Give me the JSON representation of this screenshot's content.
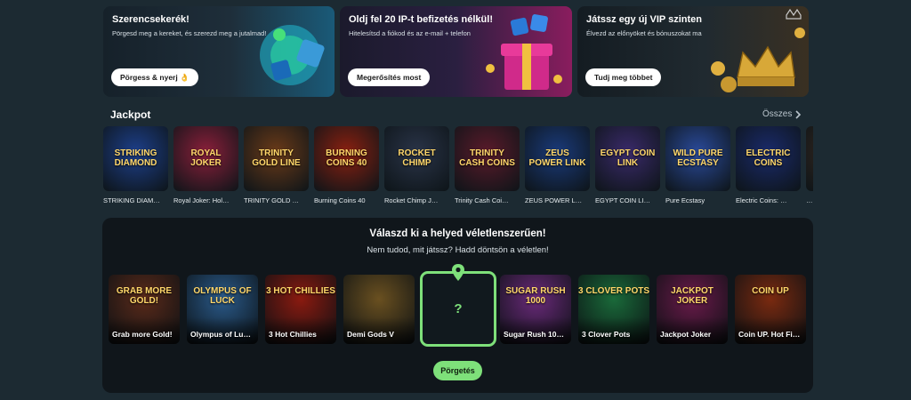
{
  "promos": [
    {
      "title": "Szerencsekerék!",
      "subtitle": "Pörgesd meg a kereket, és szerezd meg a jutalmad!",
      "button": "Pörgess & nyerj 👌"
    },
    {
      "title": "Oldj fel 20 IP-t befizetés nélkül!",
      "subtitle": "Hitelesítsd a fiókod és az e-mail + telefon",
      "button": "Megerősítés most"
    },
    {
      "title": "Játssz egy új VIP szinten",
      "subtitle": "Élvezd az előnyöket és bónuszokat ma",
      "button": "Tudj meg többet"
    }
  ],
  "jackpot": {
    "title": "Jackpot",
    "see_all": "Összes",
    "games": [
      {
        "name": "STRIKING DIAM…",
        "logo": "STRIKING DIAMOND",
        "color": "#1d3f8a"
      },
      {
        "name": "Royal Joker: Hol…",
        "logo": "ROYAL JOKER",
        "color": "#8a1f3a"
      },
      {
        "name": "TRINITY GOLD …",
        "logo": "TRINITY GOLD LINE",
        "color": "#6a3a18"
      },
      {
        "name": "Burning Coins 40",
        "logo": "BURNING COINS 40",
        "color": "#8a2010"
      },
      {
        "name": "Rocket Chimp J…",
        "logo": "ROCKET CHIMP",
        "color": "#2a3448"
      },
      {
        "name": "Trinity Cash Coi…",
        "logo": "TRINITY CASH COINS",
        "color": "#5a1a2a"
      },
      {
        "name": "ZEUS POWER L…",
        "logo": "ZEUS POWER LINK",
        "color": "#1a3a7a"
      },
      {
        "name": "EGYPT COIN LI…",
        "logo": "EGYPT COIN LINK",
        "color": "#3a2a6a"
      },
      {
        "name": "Pure Ecstasy",
        "logo": "WILD PURE ECSTASY",
        "color": "#2a4a9a"
      },
      {
        "name": "Electric Coins: …",
        "logo": "ELECTRIC COINS",
        "color": "#1a2a6a"
      },
      {
        "name": "…",
        "logo": "",
        "color": "#3a2a20"
      }
    ]
  },
  "random": {
    "title": "Válaszd ki a helyed véletlenszerűen!",
    "subtitle": "Nem tudod, mit játssz? Hadd döntsön a véletlen!",
    "selector_mark": "?",
    "spin_button": "Pörgetés",
    "games": [
      {
        "name": "Grab more Gold!",
        "logo": "GRAB MORE GOLD!",
        "color": "#5a2a1a"
      },
      {
        "name": "Olympus of Lu…",
        "logo": "OLYMPUS OF LUCK",
        "color": "#2a5a8a"
      },
      {
        "name": "3 Hot Chillies",
        "logo": "3 HOT CHILLIES",
        "color": "#8a1a10"
      },
      {
        "name": "Demi Gods V",
        "logo": "",
        "color": "#6a5020"
      },
      {
        "name": "Sugar Rush 10…",
        "logo": "SUGAR RUSH 1000",
        "color": "#6a2a7a"
      },
      {
        "name": "3 Clover Pots",
        "logo": "3 CLOVER POTS",
        "color": "#1a6a3a"
      },
      {
        "name": "Jackpot Joker",
        "logo": "JACKPOT JOKER",
        "color": "#6a1a4a"
      },
      {
        "name": "Coin UP. Hot Fi…",
        "logo": "COIN UP",
        "color": "#7a2a10"
      }
    ]
  }
}
